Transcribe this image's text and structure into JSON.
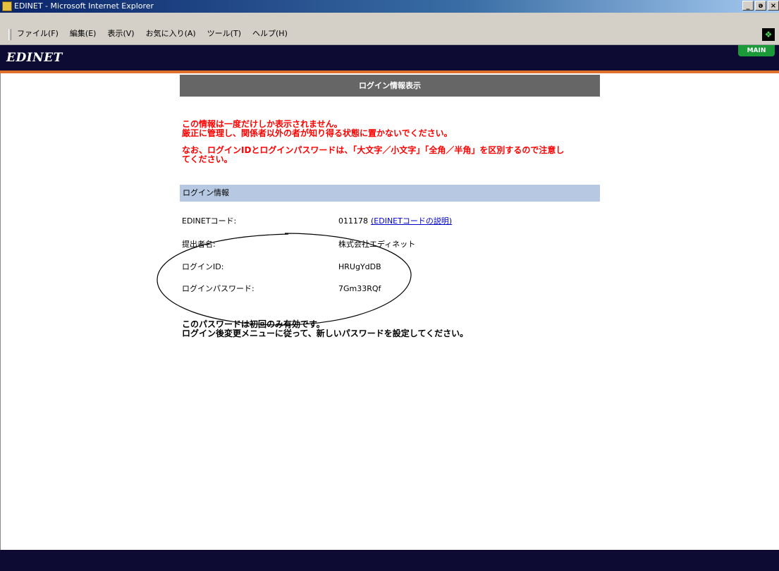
{
  "window": {
    "title": "EDINET - Microsoft Internet Explorer",
    "buttons": {
      "minimize": "_",
      "restore": "ǝ",
      "close": "×"
    }
  },
  "menubar": {
    "items": [
      "ファイル(F)",
      "編集(E)",
      "表示(V)",
      "お気に入り(A)",
      "ツール(T)",
      "ヘルプ(H)"
    ]
  },
  "site": {
    "logo": "EDINET",
    "main_tab": "MAIN"
  },
  "page": {
    "title": "ログイン情報表示",
    "warning1_line1": "この情報は一度だけしか表示されません。",
    "warning1_line2": "厳正に管理し、関係者以外の者が知り得る状態に置かないでください。",
    "warning2_line1": "なお、ログインIDとログインパスワードは、「大文字／小文字」「全角／半角」を区別するので注意し",
    "warning2_line2": "てください。",
    "section_title": "ログイン情報",
    "fields": {
      "edinet_code_label": "EDINETコード:",
      "edinet_code_value": "011178",
      "edinet_code_link": "(EDINETコードの説明)",
      "submitter_label": "提出者名:",
      "submitter_value": "株式会社エディネット",
      "login_id_label": "ログインID:",
      "login_id_value": "HRUgYdDB",
      "password_label": "ログインパスワード:",
      "password_value": "7Gm33RQf"
    },
    "note_line1": "このパスワードは初回のみ有効です。",
    "note_line2": "ログイン後変更メニューに従って、新しいパスワードを設定してください。"
  },
  "colors": {
    "header_bg": "#0d0b33",
    "header_accent": "#e0712a",
    "title_bar_bg": "#666666",
    "section_bg": "#b7c9e2",
    "warning_text": "#ff0000",
    "link": "#0000cc",
    "main_tab": "#1b9a3a"
  }
}
